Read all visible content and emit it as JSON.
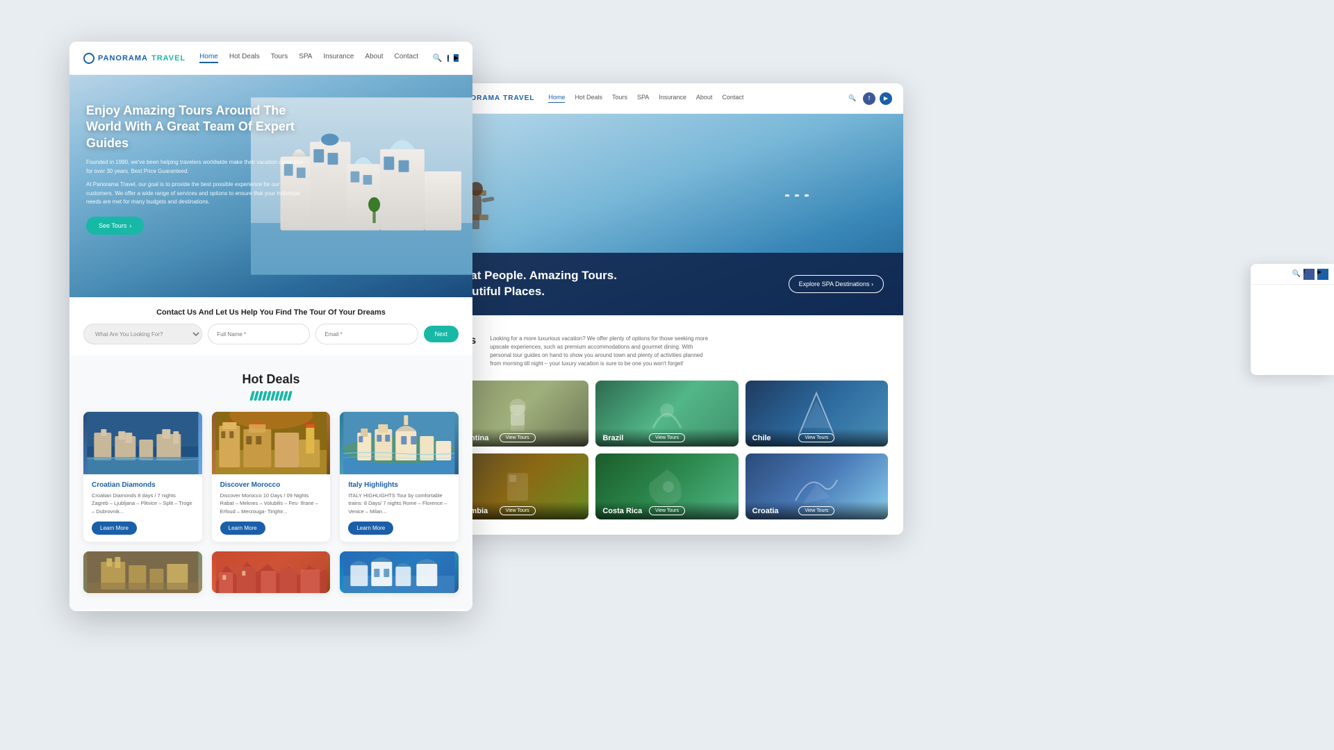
{
  "brand": {
    "name": "PANORAMA",
    "tagline": "TRAVEL",
    "globe_symbol": "⊕"
  },
  "nav": {
    "links": [
      {
        "label": "Home",
        "active": true
      },
      {
        "label": "Hot Deals",
        "active": false
      },
      {
        "label": "Tours",
        "active": false
      },
      {
        "label": "SPA",
        "active": false
      },
      {
        "label": "Insurance",
        "active": false
      },
      {
        "label": "About",
        "active": false
      },
      {
        "label": "Contact",
        "active": false
      }
    ],
    "icons": {
      "search": "search",
      "facebook": "f",
      "youtube": "▶"
    }
  },
  "hero_front": {
    "title": "Enjoy Amazing Tours Around The World With A Great Team Of Expert Guides",
    "subtitle1": "Founded in 1990, we've been helping travelers worldwide make their vacation come true for over 30 years. Best Price Guaranteed.",
    "subtitle2": "At Panorama Travel, our goal is to provide the best possible experience for our customers. We offer a wide range of services and options to ensure that your individual needs are met for many budgets and destinations.",
    "see_tours_label": "See Tours"
  },
  "hero_back": {
    "title_line1": "Great People. Amazing Tours.",
    "title_line2": "Beautiful Places.",
    "explore_btn": "Explore SPA Destinations ›"
  },
  "contact_bar": {
    "title": "Contact Us And Let Us Help You Find The Tour Of Your Dreams",
    "dropdown_placeholder": "What Are You Looking For?",
    "name_placeholder": "Full Name *",
    "email_placeholder": "Email *",
    "next_label": "Next"
  },
  "hot_deals": {
    "section_title": "Hot Deals",
    "cards": [
      {
        "title": "Croatian Diamonds",
        "description": "Croatian Diamonds 8 days / 7 nights Zagreb – Ljubljana – Plitvice – Split – Trogir – Dubrovnik...",
        "learn_more": "Learn More"
      },
      {
        "title": "Discover Morocco",
        "description": "Discover Morocco 10 Days / 09 Nights Rabat – Meknes – Volubilis – Fes- Ifrane – Erfoud – Merzouga- Tinghir...",
        "learn_more": "Learn More"
      },
      {
        "title": "Italy Highlights",
        "description": "ITALY HIGHLIGHTS Tour by comfortable trains: 8 Days/ 7 nights Rome – Florence – Venice – Milan...",
        "learn_more": "Learn More"
      }
    ]
  },
  "tours_section": {
    "title": "Tours",
    "description": "Looking for a more luxurious vacation? We offer plenty of options for those seeking more upscale experiences, such as premium accommodations and gourmet dining. With personal tour guides on hand to show you around town and plenty of activities planned from morning till night – your luxury vacation is sure to be one you won't forget!",
    "destinations": [
      {
        "name": "Argentina",
        "btn": "View Tours"
      },
      {
        "name": "Brazil",
        "btn": "View Tours"
      },
      {
        "name": "Chile",
        "btn": "View Tours"
      },
      {
        "name": "Colombia",
        "btn": "View Tours"
      },
      {
        "name": "Costa Rica",
        "btn": "View Tours"
      },
      {
        "name": "Croatia",
        "btn": "View Tours"
      }
    ]
  }
}
